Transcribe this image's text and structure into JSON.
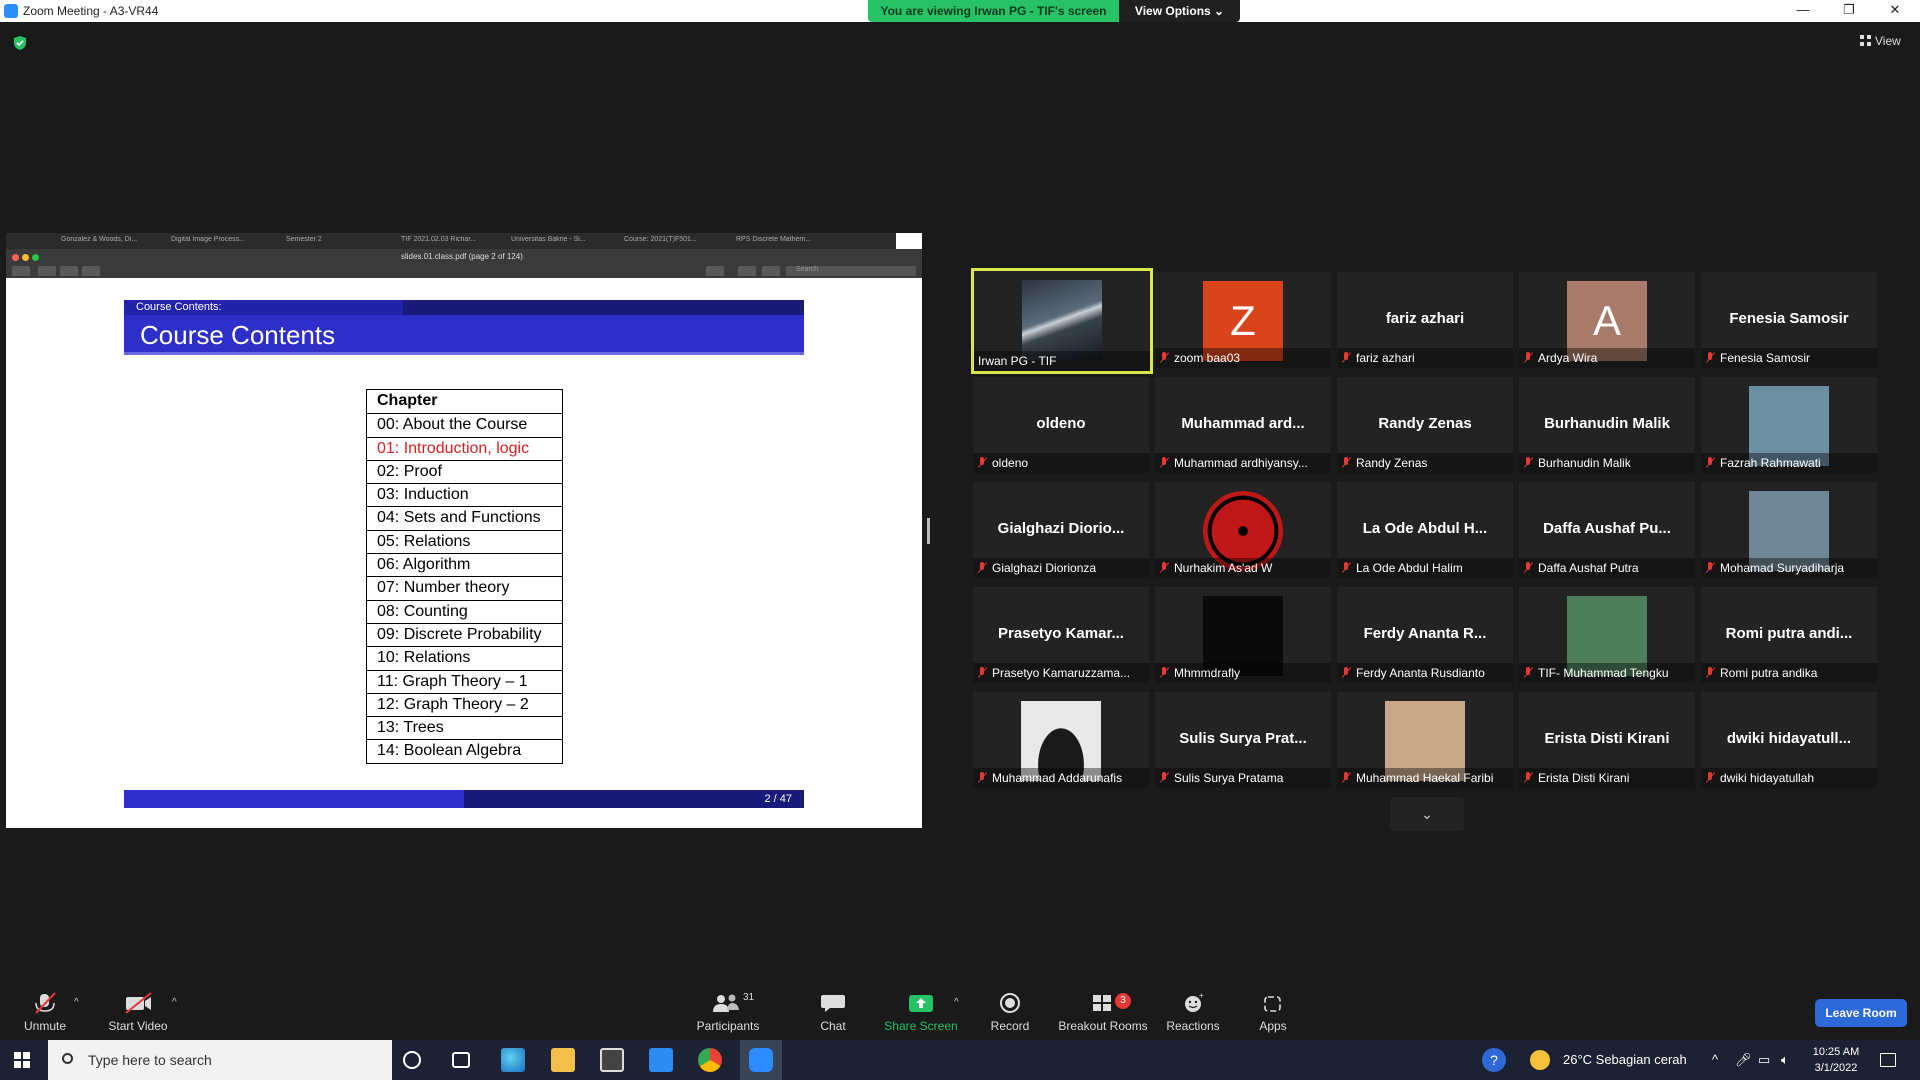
{
  "window": {
    "title": "Zoom Meeting - A3-VR44",
    "viewing_banner": "You are viewing Irwan PG - TIF's screen",
    "view_options": "View Options ⌄",
    "view_button": "View"
  },
  "shared_screen": {
    "browser_tabs": [
      "Gonzalez & Woods, Di...",
      "Digital Image Process...",
      "Semester 2",
      "TIF 2021.02.03 Richar...",
      "Universitas Bakrie - Si...",
      "Course: 2021(T)F501...",
      "RPS Discrete Mathem..."
    ],
    "pdf_title": "slides.01.class.pdf (page 2 of 124)",
    "search_placeholder": "Search",
    "slide": {
      "section": "Course Contents:",
      "title": "Course Contents",
      "page_indicator": "2 / 47",
      "table_header": "Chapter",
      "chapters": [
        {
          "text": "00: About the Course",
          "active": false
        },
        {
          "text": "01: Introduction, logic",
          "active": true
        },
        {
          "text": "02: Proof",
          "active": false
        },
        {
          "text": "03: Induction",
          "active": false
        },
        {
          "text": "04: Sets and Functions",
          "active": false
        },
        {
          "text": "05: Relations",
          "active": false
        },
        {
          "text": "06: Algorithm",
          "active": false
        },
        {
          "text": "07: Number theory",
          "active": false
        },
        {
          "text": "08: Counting",
          "active": false
        },
        {
          "text": "09: Discrete Probability",
          "active": false
        },
        {
          "text": "10: Relations",
          "active": false
        },
        {
          "text": "11: Graph Theory – 1",
          "active": false
        },
        {
          "text": "12: Graph Theory – 2",
          "active": false
        },
        {
          "text": "13: Trees",
          "active": false
        },
        {
          "text": "14: Boolean Algebra",
          "active": false
        }
      ]
    }
  },
  "participants_gallery": [
    {
      "big": "",
      "name": "Irwan PG - TIF",
      "avatar": "video",
      "muted": false,
      "active": true
    },
    {
      "big": "",
      "name": "zoom baa03",
      "avatar": "Z",
      "avatar_color": "#d9441c",
      "muted": true
    },
    {
      "big": "fariz azhari",
      "name": "fariz azhari",
      "muted": true
    },
    {
      "big": "",
      "name": "Ardya Wira",
      "avatar": "A",
      "avatar_color": "#a77a6a",
      "muted": true
    },
    {
      "big": "Fenesia Samosir",
      "name": "Fenesia Samosir",
      "muted": true
    },
    {
      "big": "oldeno",
      "name": "oldeno",
      "muted": true
    },
    {
      "big": "Muhammad  ard...",
      "name": "Muhammad ardhiyansy...",
      "muted": true
    },
    {
      "big": "Randy Zenas",
      "name": "Randy Zenas",
      "muted": true
    },
    {
      "big": "Burhanudin Malik",
      "name": "Burhanudin Malik",
      "muted": true
    },
    {
      "big": "",
      "name": "Fazrah Rahmawati",
      "avatar": "photo",
      "avatar_color": "#6d8fa3",
      "muted": true
    },
    {
      "big": "Gialghazi  Diorio...",
      "name": "Gialghazi Diorionza",
      "muted": true
    },
    {
      "big": "",
      "name": "Nurhakim As'ad W",
      "avatar": "sharingan",
      "avatar_color": "#c01818",
      "muted": true
    },
    {
      "big": "La Ode Abdul H...",
      "name": "La Ode Abdul Halim",
      "muted": true
    },
    {
      "big": "Daffa Aushaf Pu...",
      "name": "Daffa Aushaf Putra",
      "muted": true
    },
    {
      "big": "",
      "name": "Mohamad Suryadiharja",
      "avatar": "photo",
      "avatar_color": "#6f8696",
      "muted": true
    },
    {
      "big": "Prasetyo  Kamar...",
      "name": "Prasetyo Kamaruzzama...",
      "muted": true
    },
    {
      "big": "",
      "name": "Mhmmdrafly",
      "avatar": "black",
      "avatar_color": "#0a0a0a",
      "muted": true
    },
    {
      "big": "Ferdy Ananta R...",
      "name": "Ferdy Ananta Rusdianto",
      "muted": true
    },
    {
      "big": "",
      "name": "TIF- Muhammad Tengku",
      "avatar": "photo",
      "avatar_color": "#4f7f5a",
      "muted": true
    },
    {
      "big": "Romi putra andi...",
      "name": "Romi putra andika",
      "muted": true
    },
    {
      "big": "",
      "name": "Muhammad Addarunafis",
      "avatar": "hood",
      "avatar_color": "#e9e9e9",
      "muted": true
    },
    {
      "big": "Sulis Surya Prat...",
      "name": "Sulis Surya Pratama",
      "muted": true
    },
    {
      "big": "",
      "name": "Muhammad Haekal Faribi",
      "avatar": "cat",
      "avatar_color": "#c9a88a",
      "muted": true
    },
    {
      "big": "Erista Disti Kirani",
      "name": "Erista Disti Kirani",
      "muted": true
    },
    {
      "big": "dwiki  hidayatull...",
      "name": "dwiki hidayatullah",
      "muted": true
    }
  ],
  "controls": {
    "unmute": "Unmute",
    "start_video": "Start Video",
    "participants": "Participants",
    "participants_count": "31",
    "chat": "Chat",
    "share_screen": "Share Screen",
    "record": "Record",
    "breakout_rooms": "Breakout Rooms",
    "breakout_count": "3",
    "reactions": "Reactions",
    "apps": "Apps",
    "leave": "Leave Room"
  },
  "taskbar": {
    "search_placeholder": "Type here to search",
    "weather": "26°C  Sebagian cerah",
    "time": "10:25 AM",
    "date": "3/1/2022"
  },
  "colors": {
    "accent_green": "#27c166",
    "active_border": "#d9e84a",
    "leave_blue": "#2d6ad8",
    "slide_blue": "#2e2ec8"
  }
}
